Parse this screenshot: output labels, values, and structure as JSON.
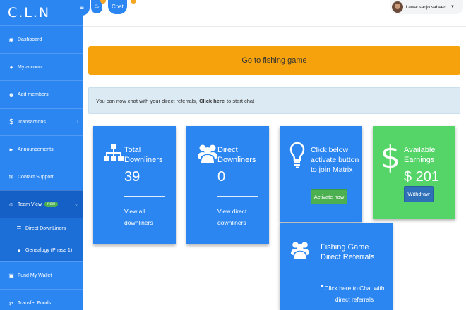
{
  "brand": "C.L.N",
  "header": {
    "menu_icon": "hamburger-icon",
    "bell_icon": "bell-icon",
    "chat_label": "Chat",
    "user_name": "Lawal sanjo saheed"
  },
  "sidebar": {
    "items": [
      {
        "label": "Dashboard",
        "icon": "dashboard-icon"
      },
      {
        "label": "My account",
        "icon": "user-icon"
      },
      {
        "label": "Add members",
        "icon": "add-user-icon"
      },
      {
        "label": "Transactions",
        "icon": "dollar-icon"
      },
      {
        "label": "Announcements",
        "icon": "megaphone-icon"
      },
      {
        "label": "Contact Support",
        "icon": "envelope-icon"
      },
      {
        "label": "Team View",
        "icon": "users-icon",
        "badge": "new"
      },
      {
        "label": "Fund My Wallet",
        "icon": "wallet-icon"
      },
      {
        "label": "Transfer Funds",
        "icon": "transfer-icon"
      }
    ],
    "sub_items": [
      {
        "label": "Direct DownLiners",
        "icon": "list-icon"
      },
      {
        "label": "Genealogy (Phase 1)",
        "icon": "sitemap-icon"
      }
    ]
  },
  "main": {
    "fishing_button": "Go to fishing game",
    "alert": {
      "text_before": "You can now chat with your direct referrals,",
      "link": "Click here",
      "text_after": "to start chat"
    },
    "cards": {
      "total": {
        "title": "Total Downliners",
        "value": "39",
        "link": "View all downliners"
      },
      "direct": {
        "title": "Direct Downliners",
        "value": "0",
        "link": "View direct downliners"
      },
      "matrix": {
        "title": "Click below activate button to join Matrix",
        "button": "Activate now"
      },
      "earnings": {
        "title": "Available Earnings",
        "value": "$ 201",
        "button": "Withdraw"
      },
      "fishing": {
        "title": "Fishing Game Direct Referrals",
        "link": "Click here to Chat with direct referrals"
      }
    }
  },
  "colors": {
    "sidebar": "#2b86f2",
    "card_blue": "#2b86f2",
    "card_green": "#55d468",
    "orange": "#f6a20c"
  }
}
